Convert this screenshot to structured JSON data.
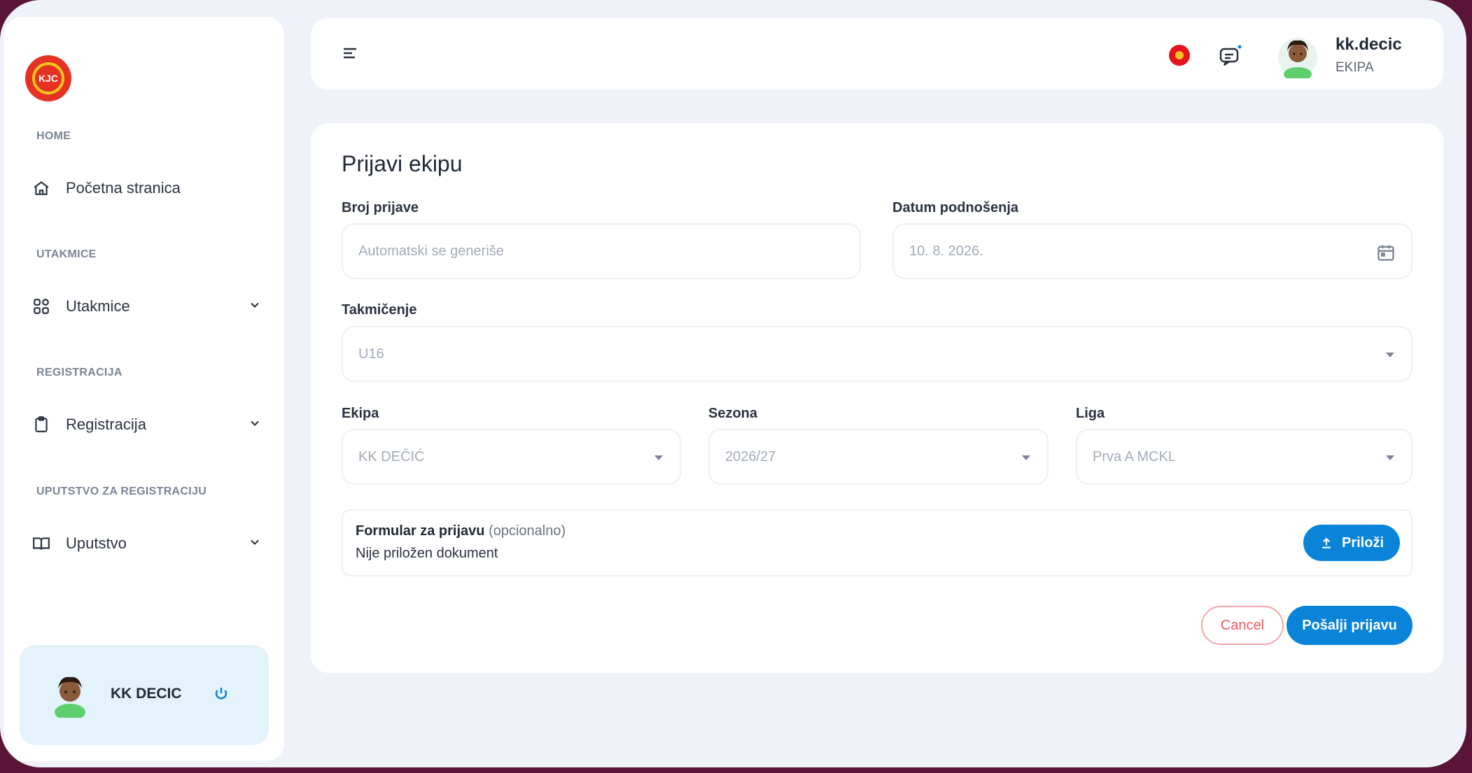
{
  "sidebar": {
    "logo_text": "KJC",
    "sections": [
      {
        "label": "HOME"
      },
      {
        "label": "UTAKMICE"
      },
      {
        "label": "REGISTRACIJA"
      },
      {
        "label": "UPUTSTVO ZA REGISTRACIJU"
      }
    ],
    "items": [
      {
        "label": "Početna stranica",
        "icon": "home-icon"
      },
      {
        "label": "Utakmice",
        "icon": "grid-icon"
      },
      {
        "label": "Registracija",
        "icon": "clipboard-icon"
      },
      {
        "label": "Uputstvo",
        "icon": "book-icon"
      }
    ],
    "user_card": {
      "name": "KK DECIC"
    }
  },
  "topbar": {
    "username": "kk.decic",
    "role": "EKIPA"
  },
  "form": {
    "title": "Prijavi ekipu",
    "broj_prijave": {
      "label": "Broj prijave",
      "placeholder": "Automatski se generiše"
    },
    "datum": {
      "label": "Datum podnošenja",
      "value": "10. 8. 2026."
    },
    "takmicenje": {
      "label": "Takmičenje",
      "value": "U16"
    },
    "ekipa": {
      "label": "Ekipa",
      "value": "KK DEČIĆ"
    },
    "sezona": {
      "label": "Sezona",
      "value": "2026/27"
    },
    "liga": {
      "label": "Liga",
      "value": "Prva A MCKL"
    },
    "attachment": {
      "title": "Formular za prijavu",
      "optional": "(opcionalno)",
      "status": "Nije priložen dokument",
      "button": "Priloži"
    },
    "cancel": "Cancel",
    "submit": "Pošalji prijavu"
  },
  "colors": {
    "accent": "#0a84d8",
    "cancel": "#ef5a63",
    "frame_border": "#5a1438"
  }
}
